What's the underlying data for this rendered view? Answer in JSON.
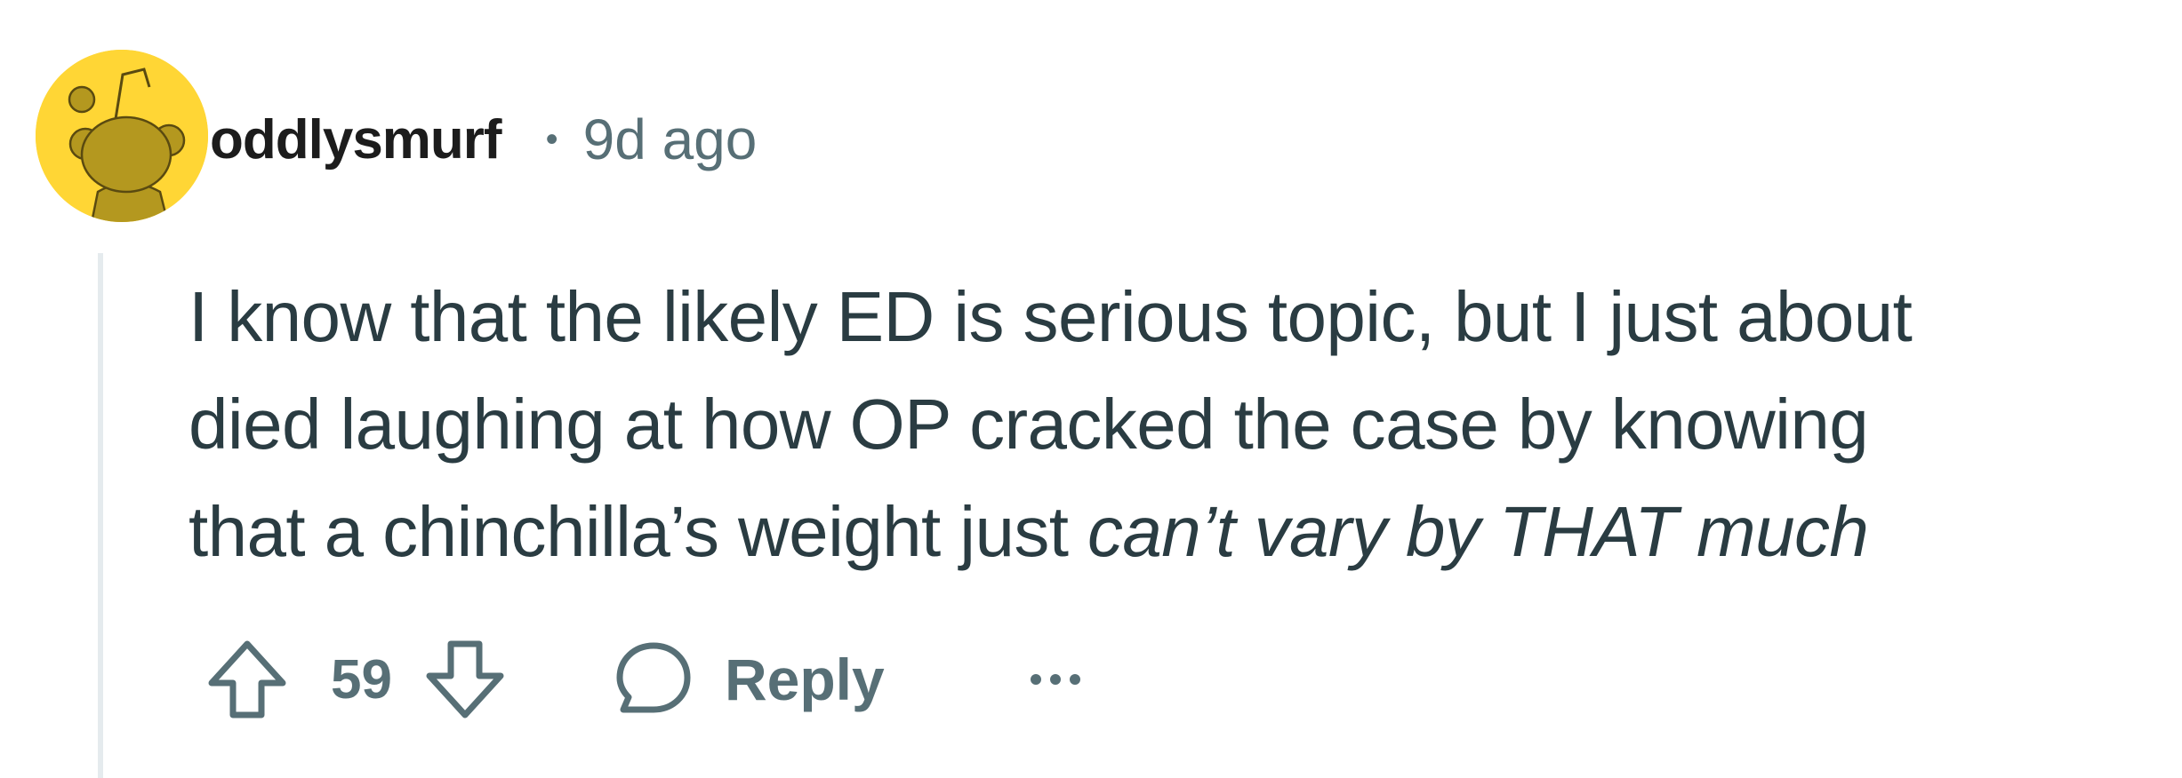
{
  "comment": {
    "author": "oddlysmurf",
    "separator": "•",
    "time_ago": "9d ago",
    "body_lines": [
      "I know that the likely ED is serious topic, but I just about",
      "died laughing at how OP cracked the case by knowing",
      "that a chinchilla’s weight just "
    ],
    "body_emphasis": "can’t vary by THAT much",
    "score": "59",
    "reply_label": "Reply"
  },
  "icons": {
    "avatar": "snoo-avatar-icon",
    "upvote": "upvote-arrow-icon",
    "downvote": "downvote-arrow-icon",
    "reply": "speech-bubble-icon",
    "more": "more-options-icon"
  },
  "colors": {
    "avatar_background": "#FFD635",
    "avatar_figure": "#B4981F",
    "text_primary": "#2a3c42",
    "text_secondary": "#576f76",
    "thread_line": "#e5ebee"
  }
}
